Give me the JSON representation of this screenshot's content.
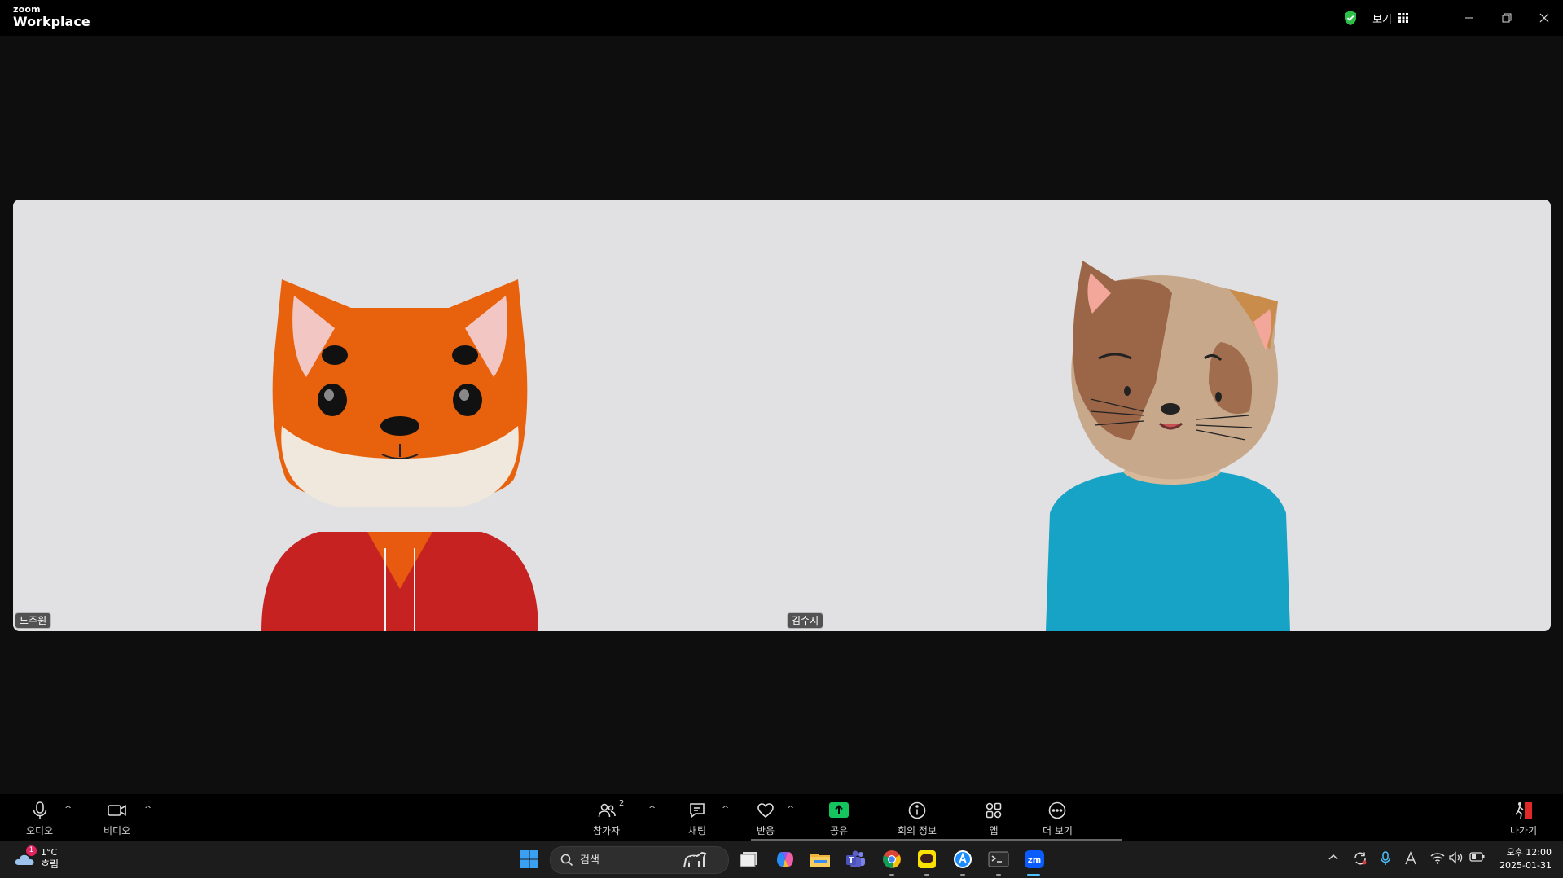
{
  "titlebar": {
    "brand_small": "zoom",
    "brand_large": "Workplace",
    "view_label": "보기",
    "colors": {
      "shield": "#2dbf4a"
    }
  },
  "participants": [
    {
      "name": "노주원",
      "avatar": "fox-avatar"
    },
    {
      "name": "김수지",
      "avatar": "cat-avatar"
    }
  ],
  "toolbar": {
    "audio": "오디오",
    "video": "비디오",
    "participants": "참가자",
    "participants_count": "2",
    "chat": "채팅",
    "reactions": "반응",
    "share": "공유",
    "meeting_info": "회의 정보",
    "apps": "앱",
    "more": "더 보기",
    "leave": "나가기",
    "colors": {
      "share": "#16c45d",
      "leave": "#e02828"
    }
  },
  "taskbar": {
    "weather_temp": "1°C",
    "weather_desc": "흐림",
    "weather_badge": "1",
    "search_placeholder": "검색",
    "clock_time": "오후 12:00",
    "clock_date": "2025-01-31",
    "apps": [
      "start-icon",
      "task-view-icon",
      "copilot-icon",
      "file-explorer-icon",
      "teams-icon",
      "chrome-icon",
      "kakaotalk-icon",
      "app-store-icon",
      "terminal-icon",
      "zoom-icon"
    ]
  }
}
